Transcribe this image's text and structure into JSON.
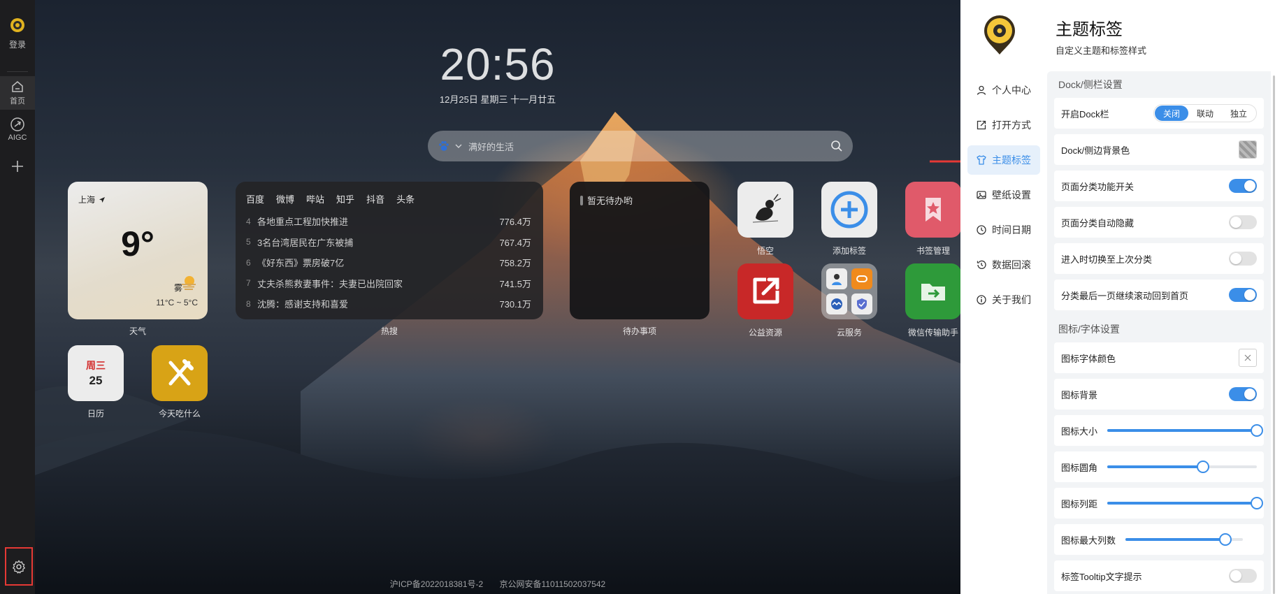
{
  "sidebar": {
    "login_label": "登录",
    "home_label": "首页",
    "aigc_label": "AIGC"
  },
  "dashboard": {
    "clock": "20:56",
    "date": "12月25日  星期三  十一月廿五",
    "search_placeholder": "满好的生活",
    "weather": {
      "city": "上海",
      "temp": "9°",
      "condition": "雾",
      "range": "11°C ~ 5°C",
      "label": "天气"
    },
    "hot": {
      "tabs": [
        "百度",
        "微博",
        "哔站",
        "知乎",
        "抖音",
        "头条"
      ],
      "rows": [
        {
          "rank": "4",
          "title": "各地重点工程加快推进",
          "count": "776.4万"
        },
        {
          "rank": "5",
          "title": "3名台湾居民在广东被捕",
          "count": "767.4万"
        },
        {
          "rank": "6",
          "title": "《好东西》票房破7亿",
          "count": "758.2万"
        },
        {
          "rank": "7",
          "title": "丈夫杀熊救妻事件：夫妻已出院回家",
          "count": "741.5万"
        },
        {
          "rank": "8",
          "title": "沈腾：感谢支持和喜爱",
          "count": "730.1万"
        }
      ],
      "label": "热搜"
    },
    "todo": {
      "text": "暂无待办哟",
      "label": "待办事项"
    },
    "apps": {
      "app1": "悟空",
      "app2": "添加标签",
      "app3": "书签管理",
      "app4": "公益资源",
      "app5": "云服务",
      "app6": "微信传输助手",
      "calendar_label": "日历",
      "calendar_weekday": "周三",
      "calendar_day": "25",
      "food_label": "今天吃什么"
    },
    "footer": {
      "icp": "沪ICP备2022018381号-2",
      "police": "京公网安备11011502037542"
    }
  },
  "panel": {
    "title": "主题标签",
    "subtitle": "自定义主题和标签样式",
    "nav": [
      "个人中心",
      "打开方式",
      "主题标签",
      "壁纸设置",
      "时间日期",
      "数据回滚",
      "关于我们"
    ],
    "sections": {
      "dock": "Dock/侧栏设置",
      "icon": "图标/字体设置"
    },
    "rows": {
      "dock_enable": "开启Dock栏",
      "dock_options": [
        "关闭",
        "联动",
        "独立"
      ],
      "dock_bg": "Dock/侧边背景色",
      "category_switch": "页面分类功能开关",
      "category_autohide": "页面分类自动隐藏",
      "switch_last": "进入时切换至上次分类",
      "scroll_back": "分类最后一页继续滚动回到首页",
      "icon_font_color": "图标字体颜色",
      "icon_bg": "图标背景",
      "icon_size": "图标大小",
      "icon_radius": "图标圆角",
      "icon_gap": "图标列距",
      "icon_max_cols": "图标最大列数",
      "tooltip": "标签Tooltip文字提示"
    },
    "values": {
      "dock_selected": "关闭",
      "category_switch": true,
      "category_autohide": false,
      "switch_last": false,
      "scroll_back": true,
      "icon_bg": true,
      "tooltip": false,
      "icon_size_pct": 100,
      "icon_radius_pct": 64,
      "icon_gap_pct": 100,
      "icon_max_cols_pct": 85
    },
    "colors": {
      "accent": "#3b8ee8",
      "arrow": "#e53935"
    }
  }
}
